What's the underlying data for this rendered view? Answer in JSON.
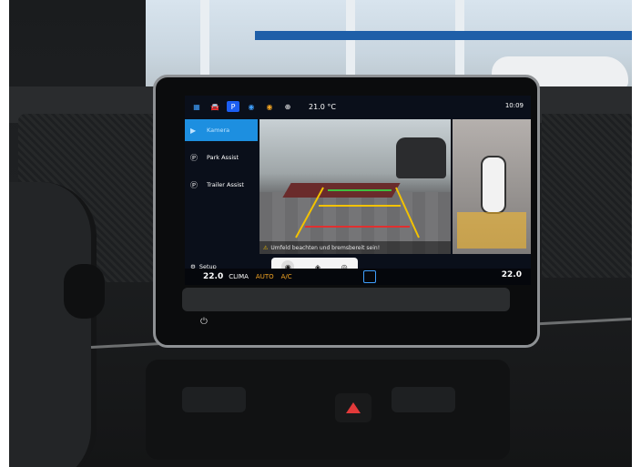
{
  "status_bar": {
    "temperature": "21.0 °C",
    "clock": "10:09",
    "icons": [
      "apps-grid-icon",
      "car-icon",
      "parking-icon",
      "assist-icon",
      "light-icon",
      "add-icon",
      "notification-icon",
      "user-icon",
      "location-icon"
    ]
  },
  "menu": {
    "items": [
      {
        "label": "Kamera",
        "icon": "camera-icon",
        "active": true
      },
      {
        "label": "Park Assist",
        "icon": "park-assist-icon",
        "active": false
      },
      {
        "label": "Trailer Assist",
        "icon": "trailer-assist-icon",
        "active": false
      }
    ],
    "setup_label": "Setup"
  },
  "camera": {
    "warning_text": "Umfeld beachten und bremsbereit sein!"
  },
  "climate": {
    "left_temp": "22.0",
    "clima_label": "CLIMA",
    "auto_label": "AUTO",
    "ac_label": "A/C",
    "right_temp": "22.0"
  }
}
